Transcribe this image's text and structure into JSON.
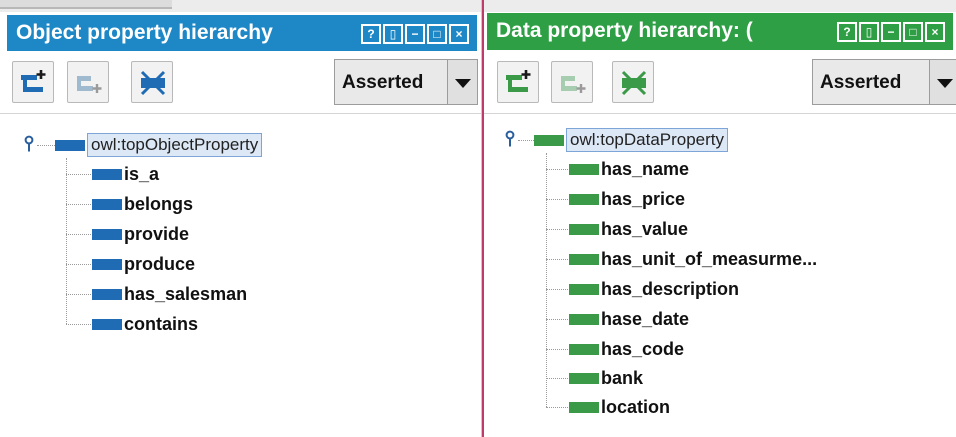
{
  "left_panel": {
    "title": "Object property hierarchy",
    "window_buttons": [
      "?",
      "▯",
      "−",
      "□",
      "×"
    ],
    "mode_select": {
      "selected": "Asserted"
    },
    "root": "owl:topObjectProperty",
    "children": [
      "is_a",
      "belongs",
      "provide",
      "produce",
      "has_salesman",
      "contains"
    ],
    "property_color": "#1f6cb4",
    "title_color": "#1e88c7"
  },
  "right_panel": {
    "title": "Data property hierarchy: (",
    "window_buttons": [
      "?",
      "▯",
      "−",
      "□",
      "×"
    ],
    "mode_select": {
      "selected": "Asserted"
    },
    "root": "owl:topDataProperty",
    "children": [
      "has_name",
      "has_price",
      "has_value",
      "has_unit_of_measurme...",
      "has_description",
      "hase_date",
      "has_code",
      "bank",
      "location"
    ],
    "property_color": "#3a9a47",
    "title_color": "#2f9f45"
  },
  "icons": {
    "add_sub_property": "add-sub-property-icon",
    "add_sibling_property": "add-sibling-property-icon",
    "delete_property": "delete-property-icon",
    "tree_root": "pin-icon"
  }
}
